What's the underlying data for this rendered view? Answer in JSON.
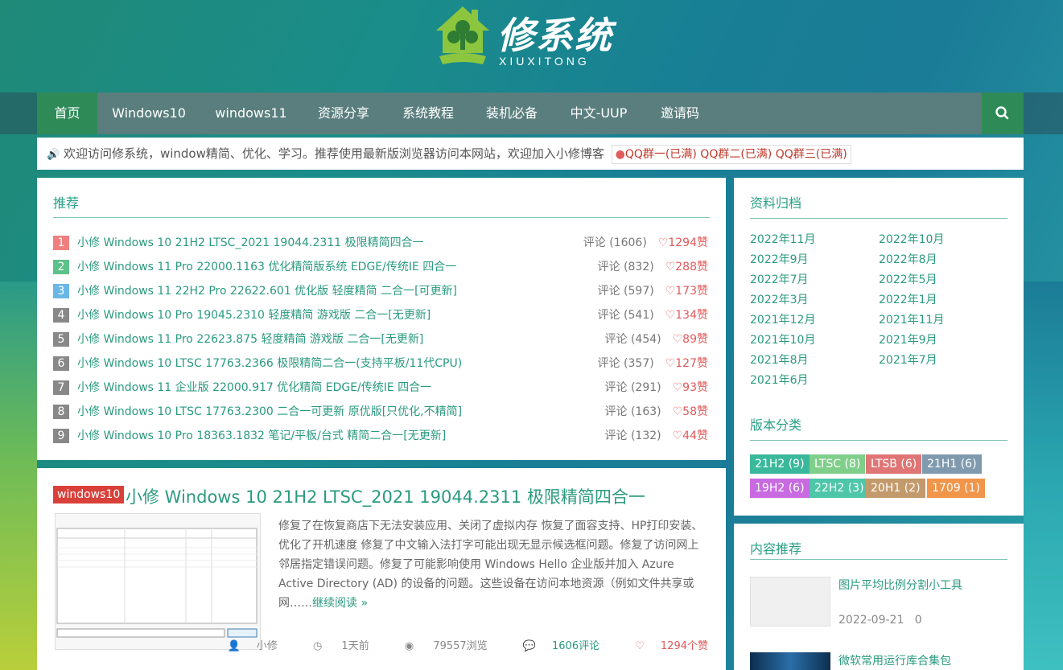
{
  "brand": {
    "name": "修系统",
    "sub": "XIUXITONG"
  },
  "nav": {
    "items": [
      "首页",
      "Windows10",
      "windows11",
      "资源分享",
      "系统教程",
      "装机必备",
      "中文-UUP",
      "邀请码"
    ]
  },
  "notice": {
    "text": "欢迎访问修系统，window精简、优化、学习。推荐使用最新版浏览器访问本网站，欢迎加入小修博客",
    "qq": "QQ群一(已满) QQ群二(已满) QQ群三(已满)"
  },
  "recommend": {
    "title": "推荐",
    "items": [
      {
        "num": "1",
        "title": "小修 Windows 10 21H2 LTSC_2021 19044.2311 极限精简四合一",
        "comments": "评论 (1606)",
        "likes": "1294赞",
        "color": "#f08080"
      },
      {
        "num": "2",
        "title": "小修 Windows 11 Pro 22000.1163 优化精简版系统 EDGE/传统IE 四合一",
        "comments": "评论 (832)",
        "likes": "288赞",
        "color": "#5cc28a"
      },
      {
        "num": "3",
        "title": "小修 Windows 11 22H2 Pro 22622.601 优化版 轻度精简 二合一[可更新]",
        "comments": "评论 (597)",
        "likes": "173赞",
        "color": "#6ab7e6"
      },
      {
        "num": "4",
        "title": "小修 Windows 10 Pro 19045.2310 轻度精简 游戏版 二合一[无更新]",
        "comments": "评论 (541)",
        "likes": "134赞",
        "color": "#888"
      },
      {
        "num": "5",
        "title": "小修 Windows 11 Pro 22623.875 轻度精简 游戏版 二合一[无更新]",
        "comments": "评论 (454)",
        "likes": "89赞",
        "color": "#888"
      },
      {
        "num": "6",
        "title": "小修 Windows 10 LTSC 17763.2366 极限精简二合一(支持平板/11代CPU)",
        "comments": "评论 (357)",
        "likes": "127赞",
        "color": "#888"
      },
      {
        "num": "7",
        "title": "小修 Windows 11 企业版 22000.917 优化精简 EDGE/传统IE 四合一",
        "comments": "评论 (291)",
        "likes": "93赞",
        "color": "#888"
      },
      {
        "num": "8",
        "title": "小修 Windows 10 LTSC 17763.2300 二合一可更新 原优版[只优化,不精简]",
        "comments": "评论 (163)",
        "likes": "58赞",
        "color": "#888"
      },
      {
        "num": "9",
        "title": "小修 Windows 10 Pro 18363.1832 笔记/平板/台式 精简二合一[无更新]",
        "comments": "评论 (132)",
        "likes": "44赞",
        "color": "#888"
      }
    ]
  },
  "post": {
    "category": "windows10",
    "title": "小修 Windows 10 21H2 LTSC_2021 19044.2311 极限精简四合一",
    "excerpt": "修复了在恢复商店下无法安装应用、关闭了虚拟内存 恢复了面容支持、HP打印安装、优化了开机速度 修复了中文输入法打字可能出现无显示候选框问题。修复了访问网上邻居指定错误问题。修复了可能影响使用 Windows Hello 企业版并加入 Azure Active Directory (AD) 的设备的问题。这些设备在访问本地资源（例如文件共享或网……",
    "more": "继续阅读 »",
    "author": "小修",
    "time": "1天前",
    "views": "79557浏览",
    "comments": "1606评论",
    "likes": "1294个赞"
  },
  "archive": {
    "title": "资料归档",
    "months": [
      "2022年11月",
      "2022年10月",
      "2022年9月",
      "2022年8月",
      "2022年7月",
      "2022年5月",
      "2022年3月",
      "2022年1月",
      "2021年12月",
      "2021年11月",
      "2021年10月",
      "2021年9月",
      "2021年8月",
      "2021年7月",
      "2021年6月"
    ]
  },
  "versions": {
    "title": "版本分类",
    "tags": [
      {
        "label": "21H2 (9)",
        "color": "#3ab89b"
      },
      {
        "label": "LTSC (8)",
        "color": "#7fcf8a"
      },
      {
        "label": "LTSB (6)",
        "color": "#e07575"
      },
      {
        "label": "21H1 (6)",
        "color": "#7f9aae"
      },
      {
        "label": "19H2 (6)",
        "color": "#c86ae0"
      },
      {
        "label": "22H2 (3)",
        "color": "#4ec6a8"
      },
      {
        "label": "20H1 (2)",
        "color": "#c39a6b"
      },
      {
        "label": "1709 (1)",
        "color": "#f0954a"
      }
    ]
  },
  "content_rec": {
    "title": "内容推荐",
    "items": [
      {
        "title": "图片平均比例分割小工具",
        "date": "2022-09-21",
        "count": "0"
      },
      {
        "title": "微软常用运行库合集包"
      }
    ]
  }
}
